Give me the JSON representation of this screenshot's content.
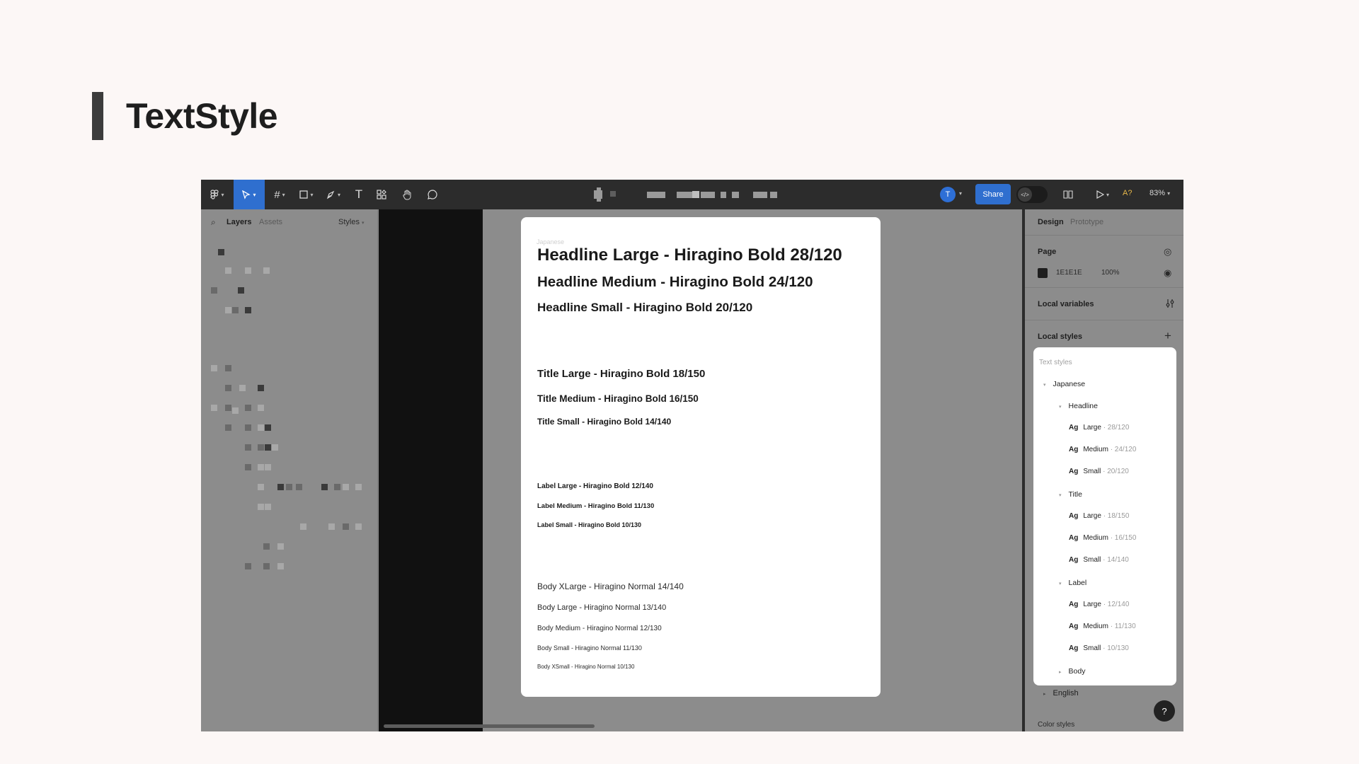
{
  "slide": {
    "title": "TextStyle"
  },
  "toolbar": {
    "avatar_initial": "T",
    "share_label": "Share",
    "dev_mode_icon": "</>",
    "ai_label": "A?",
    "zoom_label": "83%"
  },
  "left_panel": {
    "tabs": {
      "layers": "Layers",
      "assets": "Assets",
      "styles": "Styles"
    }
  },
  "canvas": {
    "frame_label": "Japanese",
    "styles": [
      "Headline Large - Hiragino Bold 28/120",
      "Headline Medium - Hiragino Bold 24/120",
      "Headline Small - Hiragino Bold 20/120",
      "Title Large - Hiragino Bold 18/150",
      "Title Medium - Hiragino Bold 16/150",
      "Title Small - Hiragino Bold 14/140",
      "Label Large - Hiragino Bold 12/140",
      "Label Medium - Hiragino Bold 11/130",
      "Label Small - Hiragino Bold 10/130",
      "Body XLarge - Hiragino Normal 14/140",
      "Body Large - Hiragino Normal 13/140",
      "Body Medium - Hiragino Normal 12/130",
      "Body Small - Hiragino Normal 11/130",
      "Body XSmall - Hiragino Normal 10/130"
    ]
  },
  "right_panel": {
    "tabs": {
      "design": "Design",
      "prototype": "Prototype"
    },
    "page_label": "Page",
    "page_color": "1E1E1E",
    "page_opacity": "100%",
    "local_variables": "Local variables",
    "local_styles": "Local styles",
    "text_styles_heading": "Text styles",
    "groups": {
      "japanese": "Japanese",
      "headline": "Headline",
      "title": "Title",
      "label": "Label",
      "body": "Body",
      "english": "English"
    },
    "items": {
      "headline": [
        {
          "ag": "Ag",
          "name": "Large",
          "meta": " · 28/120"
        },
        {
          "ag": "Ag",
          "name": "Medium",
          "meta": " · 24/120"
        },
        {
          "ag": "Ag",
          "name": "Small",
          "meta": " · 20/120"
        }
      ],
      "title": [
        {
          "ag": "Ag",
          "name": "Large",
          "meta": " · 18/150"
        },
        {
          "ag": "Ag",
          "name": "Medium",
          "meta": " · 16/150"
        },
        {
          "ag": "Ag",
          "name": "Small",
          "meta": " · 14/140"
        }
      ],
      "label": [
        {
          "ag": "Ag",
          "name": "Large",
          "meta": " · 12/140"
        },
        {
          "ag": "Ag",
          "name": "Medium",
          "meta": " · 11/130"
        },
        {
          "ag": "Ag",
          "name": "Small",
          "meta": " · 10/130"
        }
      ]
    },
    "color_styles": "Color styles",
    "help_label": "?"
  }
}
